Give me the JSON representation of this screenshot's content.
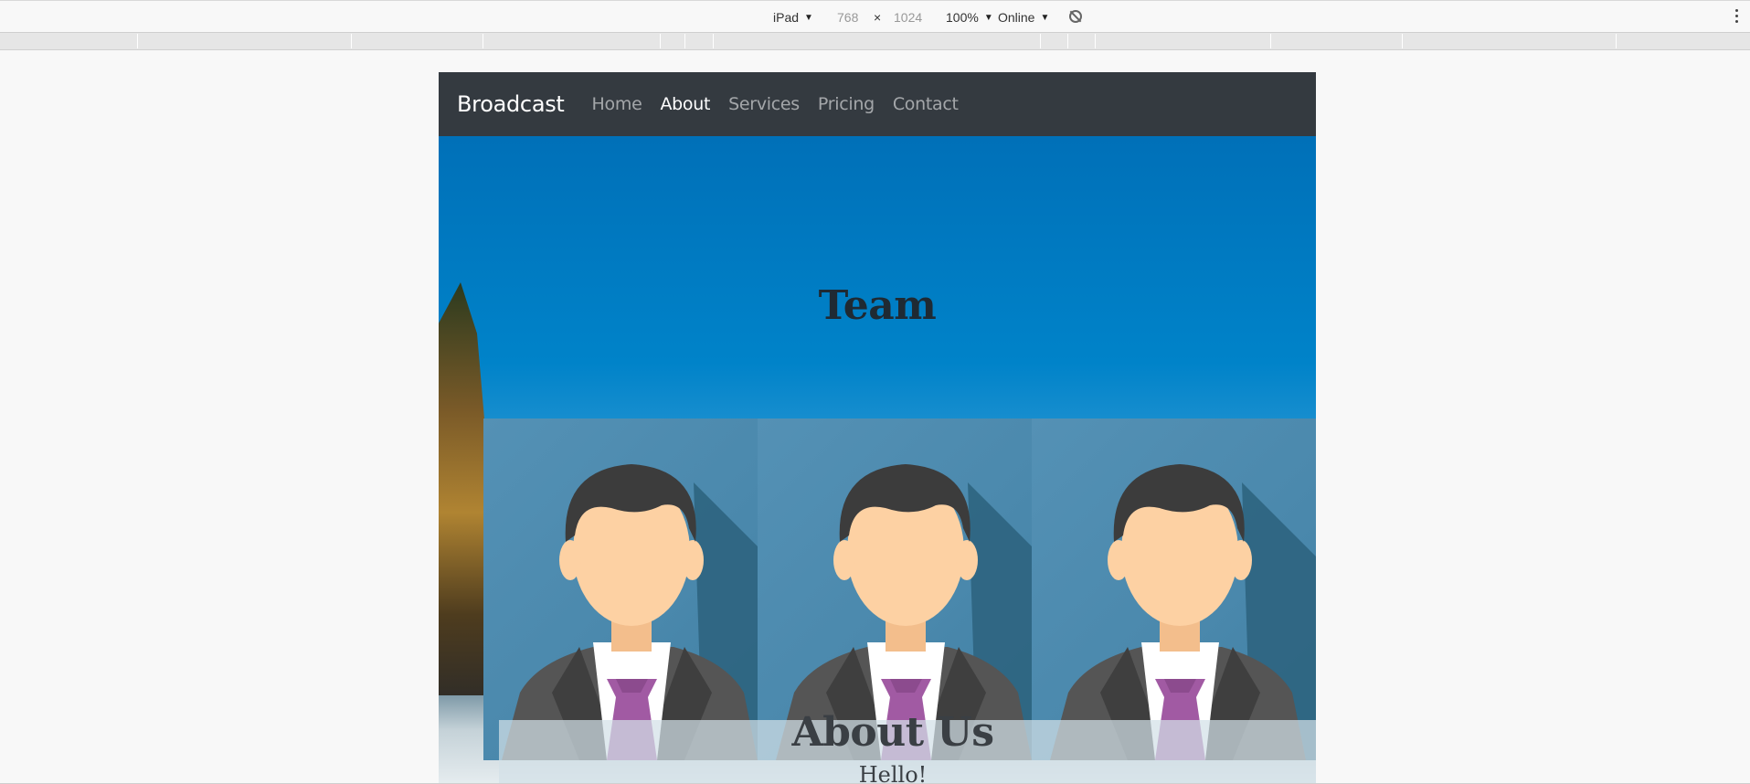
{
  "devtools": {
    "device": "iPad",
    "width": "768",
    "times": "×",
    "height": "1024",
    "zoom": "100%",
    "network": "Online"
  },
  "navbar": {
    "brand": "Broadcast",
    "links": [
      "Home",
      "About",
      "Services",
      "Pricing",
      "Contact"
    ],
    "active": "About"
  },
  "hero": {
    "title": "Team"
  },
  "team": {
    "members": [
      {
        "avatar": "man-in-suit-avatar-icon"
      },
      {
        "avatar": "man-in-suit-avatar-icon"
      },
      {
        "avatar": "man-in-suit-avatar-icon"
      }
    ]
  },
  "about": {
    "title": "About Us",
    "subtitle": "Hello!"
  },
  "colors": {
    "navbar_bg": "#343a40",
    "avatar_bg": "#4a88ac",
    "hair": "#3c3c3c",
    "skin": "#fdd1a3",
    "suit": "#555555",
    "tie": "#a15aa3"
  }
}
